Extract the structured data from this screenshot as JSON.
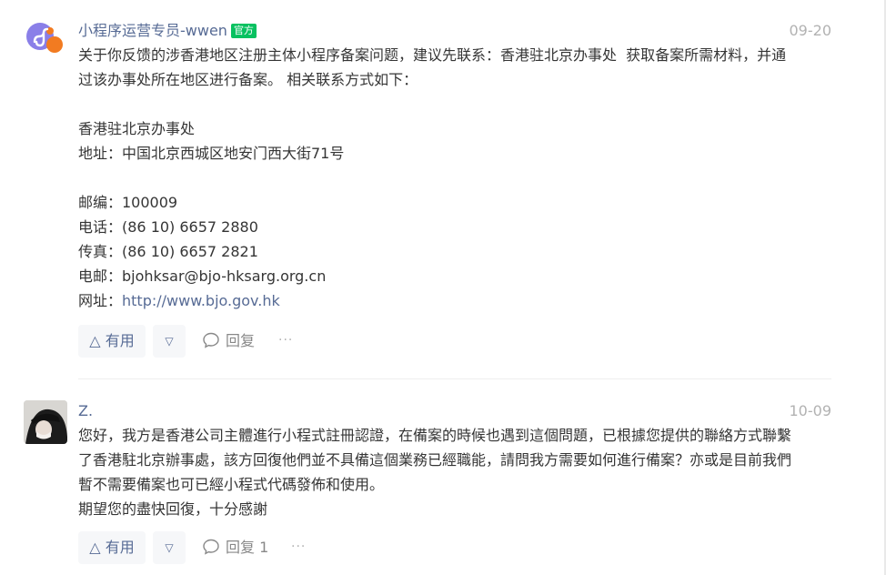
{
  "comments": [
    {
      "author": "小程序运营专员-wwen",
      "badge": "官方",
      "date": "09-20",
      "lines": [
        "关于你反馈的涉香港地区注册主体小程序备案问题，建议先联系：香港驻北京办事处  获取备案所需材料，并通",
        "过该办事处所在地区进行备案。 相关联系方式如下：",
        "",
        "香港驻北京办事处",
        "地址：中国北京西城区地安门西大街71号",
        "",
        "邮编：100009",
        "电话：(86 10) 6657 2880",
        "传真：(86 10) 6657 2821",
        "电邮：bjohksar@bjo-hksarg.org.cn"
      ],
      "website_label": "网址：",
      "website_url": "http://www.bjo.gov.hk",
      "like_label": "有用",
      "reply_label": "回复",
      "more_label": "···",
      "icons": {
        "avatar": "mini-program-logo",
        "like": "triangle-up-icon",
        "dislike": "triangle-down-icon",
        "reply": "comment-bubble-icon"
      }
    },
    {
      "author": "Z.",
      "date": "10-09",
      "lines": [
        "您好，我方是香港公司主體進行小程式註冊認證，在備案的時候也遇到這個問題，已根據您提供的聯絡方式聯繫",
        "了香港駐北京辦事處，該方回復他們並不具備這個業務已經職能，請問我方需要如何進行備案？亦或是目前我們",
        "暫不需要備案也可已經小程式代碼發佈和使用。",
        "期望您的盡快回復，十分感謝"
      ],
      "like_label": "有用",
      "reply_label": "回复 1",
      "more_label": "···",
      "icons": {
        "avatar": "user-photo",
        "like": "triangle-up-icon",
        "dislike": "triangle-down-icon",
        "reply": "comment-bubble-icon"
      }
    }
  ],
  "colors": {
    "link": "#576b95",
    "badge": "#07c160",
    "date": "#b2b2b2",
    "text": "#353535"
  }
}
